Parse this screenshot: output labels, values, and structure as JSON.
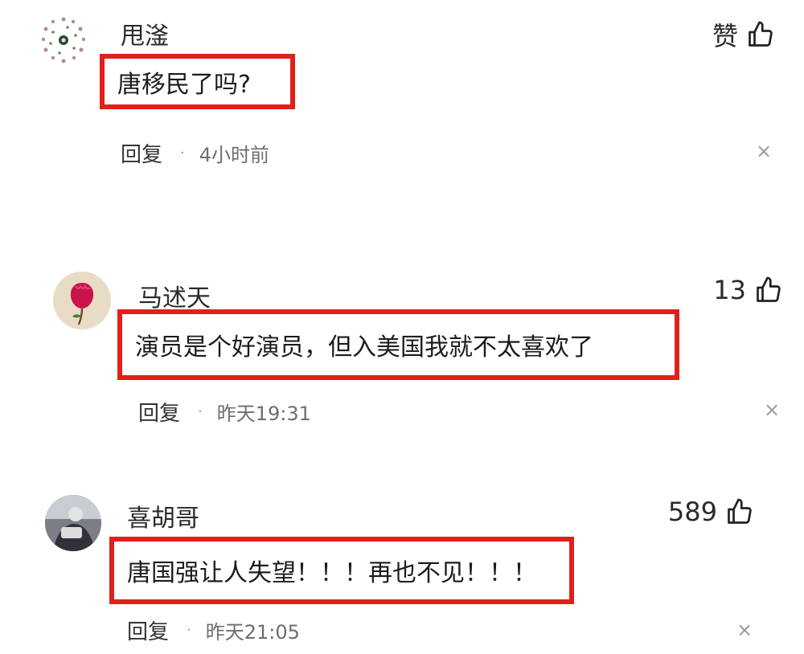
{
  "comments": [
    {
      "username": "甩滏",
      "text": "唐移民了吗?",
      "like_label": "赞",
      "reply_label": "回复",
      "dot": "·",
      "time": "4小时前",
      "close": "×"
    },
    {
      "username": "马述天",
      "text": "演员是个好演员，但入美国我就不太喜欢了",
      "like_label": "13",
      "reply_label": "回复",
      "dot": "·",
      "time": "昨天19:31",
      "close": "×"
    },
    {
      "username": "喜胡哥",
      "text": "唐国强让人失望！！！再也不见！！！",
      "like_label": "589",
      "reply_label": "回复",
      "dot": "·",
      "time": "昨天21:05",
      "close": "×"
    }
  ],
  "highlight_color": "#e2201b",
  "icons": {
    "like": "thumbs-up-icon",
    "close": "close-icon"
  }
}
